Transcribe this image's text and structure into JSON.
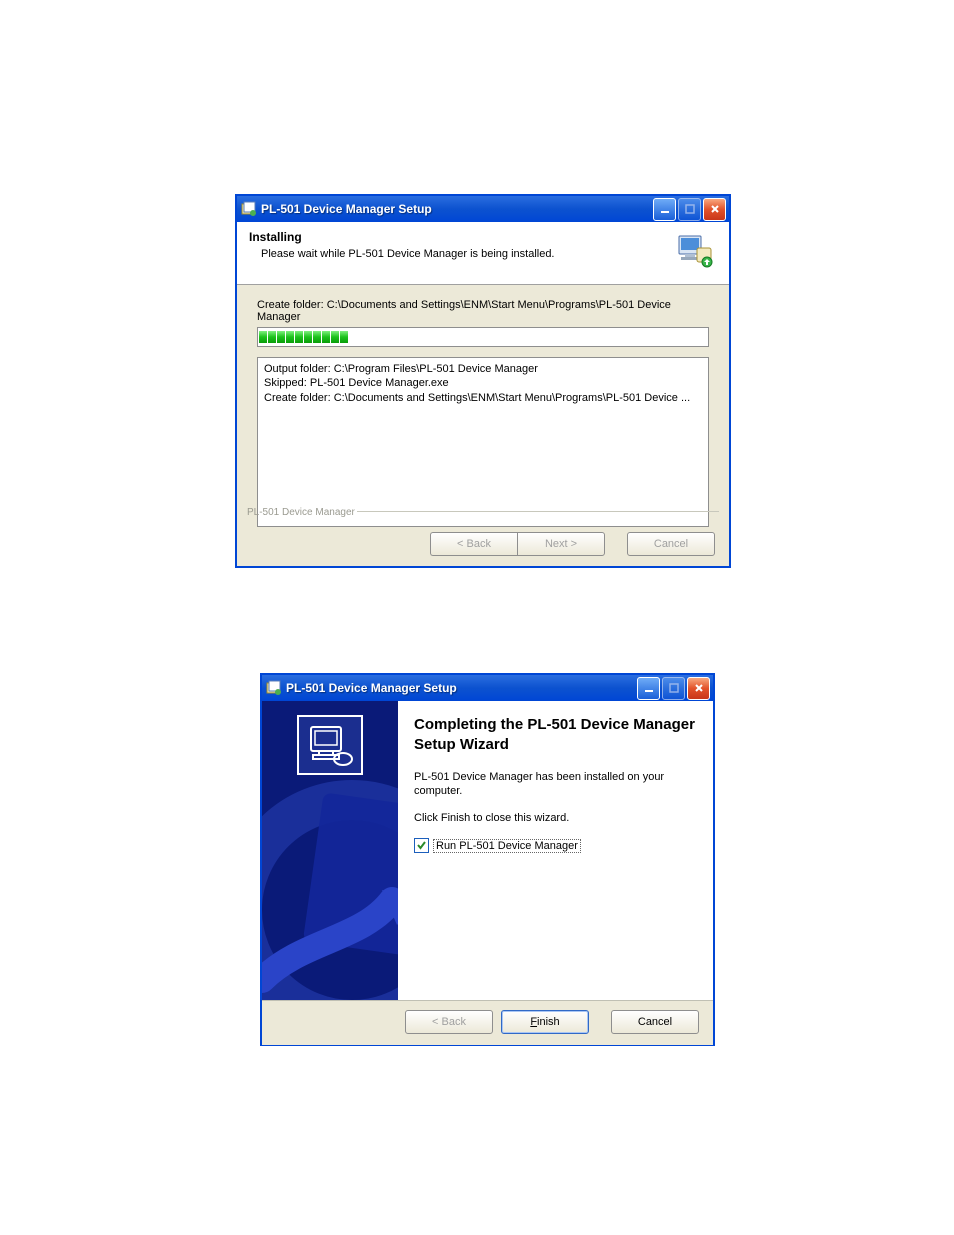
{
  "window1": {
    "title": "PL-501 Device Manager Setup",
    "header_title": "Installing",
    "header_sub": "Please wait while PL-501 Device Manager is being installed.",
    "status": "Create folder: C:\\Documents and Settings\\ENM\\Start Menu\\Programs\\PL-501 Device Manager",
    "log": [
      "Output folder: C:\\Program Files\\PL-501 Device Manager",
      "Skipped: PL-501 Device Manager.exe",
      "Create folder: C:\\Documents and Settings\\ENM\\Start Menu\\Programs\\PL-501 Device ..."
    ],
    "footer_brand": "PL-501 Device Manager",
    "buttons": {
      "back": "< Back",
      "next": "Next >",
      "cancel": "Cancel"
    },
    "progress_blocks": 10
  },
  "window2": {
    "title": "PL-501 Device Manager Setup",
    "main_title": "Completing the PL-501 Device Manager Setup Wizard",
    "para1": "PL-501 Device Manager has been installed on your computer.",
    "para2": "Click Finish to close this wizard.",
    "checkbox_label": "Run PL-501 Device Manager",
    "checkbox_checked": true,
    "buttons": {
      "back": "< Back",
      "finish_u": "F",
      "finish_rest": "inish",
      "cancel": "Cancel"
    }
  }
}
